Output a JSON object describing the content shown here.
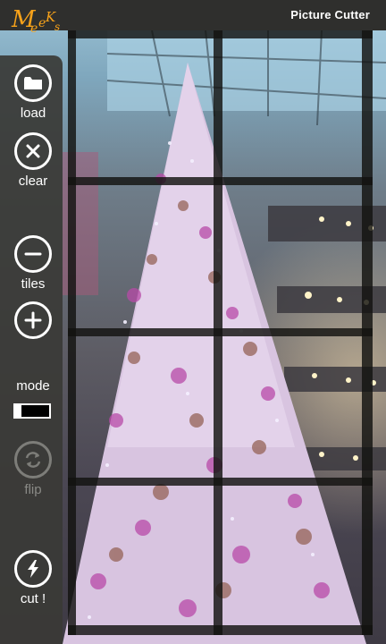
{
  "header": {
    "title": "Picture Cutter",
    "logo_text": "MeeKs"
  },
  "sidebar": {
    "load": {
      "label": "load",
      "icon": "folder-icon"
    },
    "clear": {
      "label": "clear",
      "icon": "close-icon"
    },
    "tiles": {
      "label": "tiles",
      "decrease_icon": "minus-icon",
      "increase_icon": "plus-icon"
    },
    "mode": {
      "label": "mode"
    },
    "flip": {
      "label": "flip",
      "icon": "refresh-icon",
      "enabled": false
    },
    "cut": {
      "label": "cut !",
      "icon": "lightning-icon"
    }
  },
  "grid": {
    "rows": 4,
    "columns": 2
  },
  "colors": {
    "accent": "#f7a21a",
    "panel": "#3a3a36",
    "grid": "#121210"
  }
}
